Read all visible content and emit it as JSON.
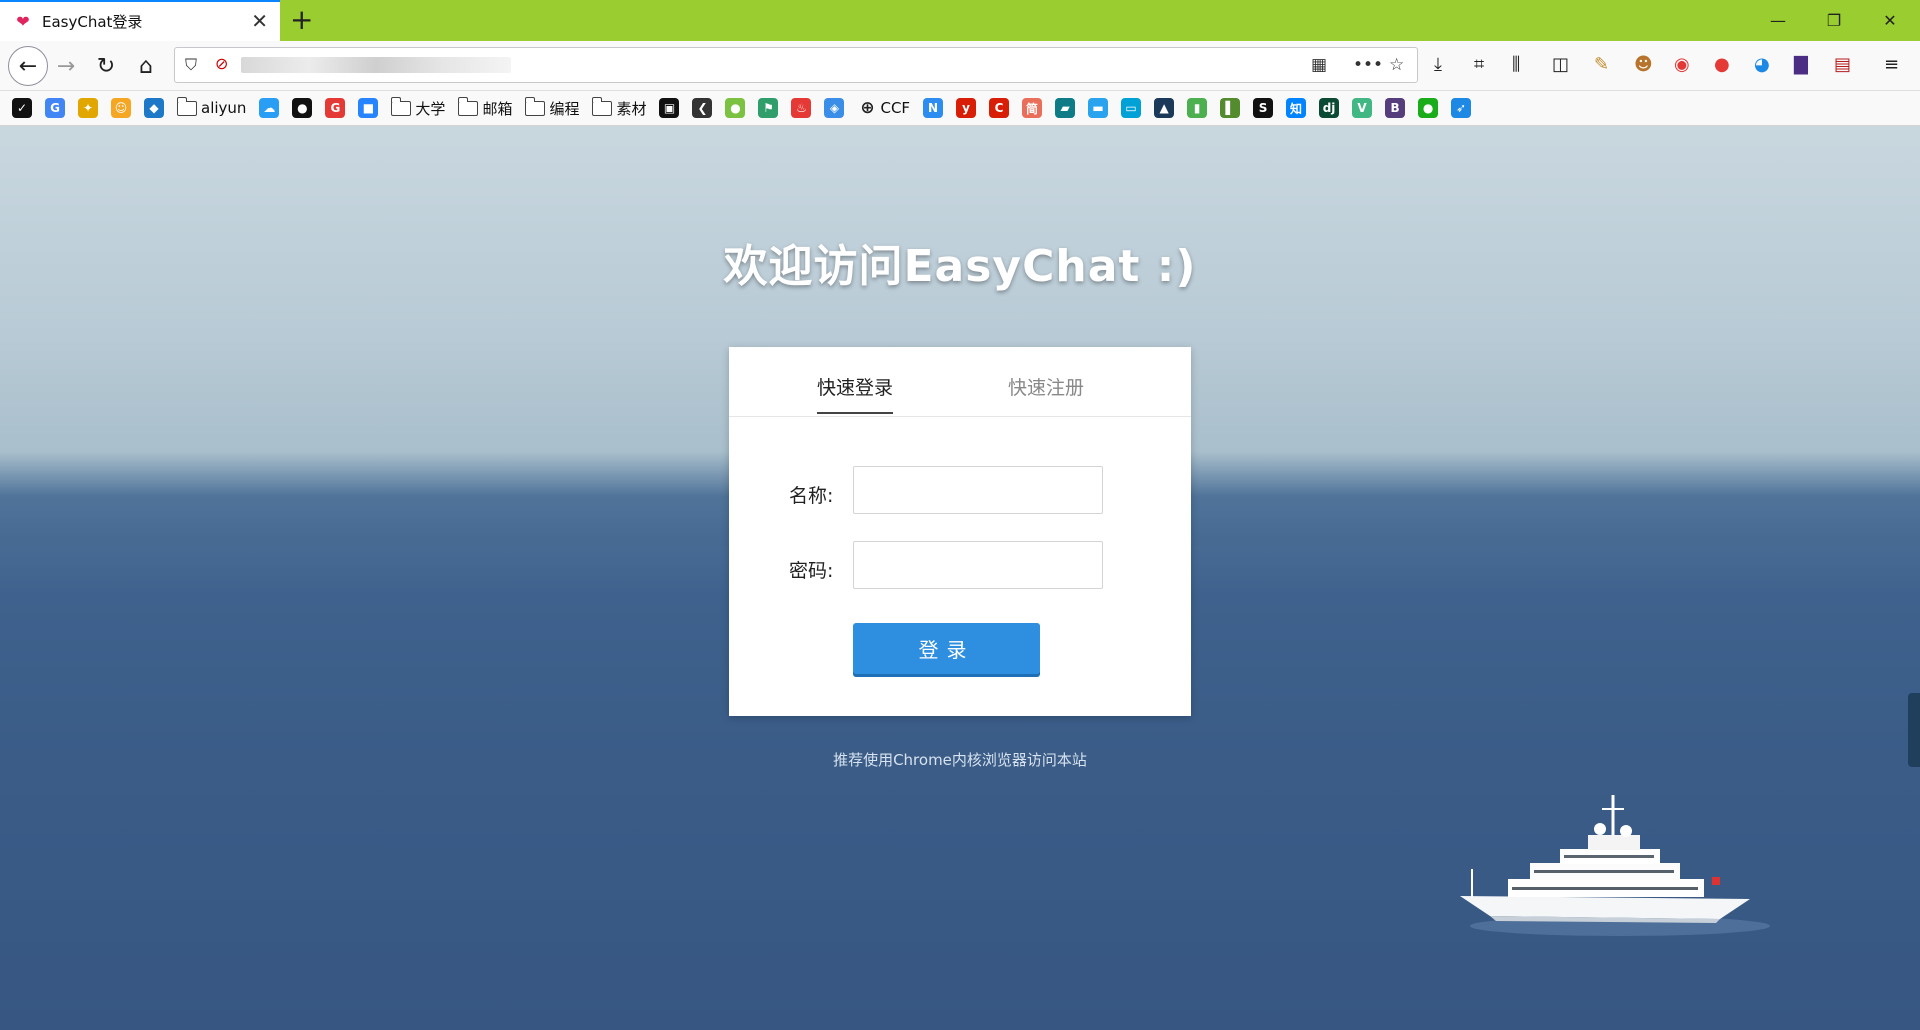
{
  "browser": {
    "tab_title": "EasyChat登录",
    "new_tab": "+",
    "window_controls": {
      "minimize": "—",
      "restore": "❐",
      "close": "✕"
    },
    "nav_icons": [
      "back-icon",
      "forward-icon",
      "reload-icon",
      "home-icon"
    ],
    "bookmarks": [
      {
        "type": "icon",
        "name": "pocket-icon",
        "glyph": "✓",
        "color": "#111111"
      },
      {
        "type": "icon",
        "name": "google-icon",
        "glyph": "G",
        "color": "#4285f4"
      },
      {
        "type": "icon",
        "name": "bird-icon",
        "glyph": "✦",
        "color": "#e2a600"
      },
      {
        "type": "icon",
        "name": "smile-icon",
        "glyph": "☺",
        "color": "#f5a623"
      },
      {
        "type": "icon",
        "name": "diamond-icon",
        "glyph": "◆",
        "color": "#1e78c8"
      },
      {
        "type": "folder",
        "label": "aliyun"
      },
      {
        "type": "icon",
        "name": "cloud-icon",
        "glyph": "☁",
        "color": "#2a9df4"
      },
      {
        "type": "icon",
        "name": "github-icon",
        "glyph": "●",
        "color": "#111111"
      },
      {
        "type": "icon",
        "name": "g-red-icon",
        "glyph": "G",
        "color": "#e53935"
      },
      {
        "type": "icon",
        "name": "bitbucket-icon",
        "glyph": "■",
        "color": "#2684ff"
      },
      {
        "type": "folder",
        "label": "大学"
      },
      {
        "type": "folder",
        "label": "邮箱"
      },
      {
        "type": "folder",
        "label": "编程"
      },
      {
        "type": "folder",
        "label": "素材"
      },
      {
        "type": "icon",
        "name": "black-box-icon",
        "glyph": "▣",
        "color": "#111111"
      },
      {
        "type": "icon",
        "name": "arrow-icon",
        "glyph": "❮",
        "color": "#333333"
      },
      {
        "type": "icon",
        "name": "green-circle-icon",
        "glyph": "●",
        "color": "#7cc242"
      },
      {
        "type": "icon",
        "name": "flag-icon",
        "glyph": "⚑",
        "color": "#2f9e6a"
      },
      {
        "type": "icon",
        "name": "fire-icon",
        "glyph": "♨",
        "color": "#e53935"
      },
      {
        "type": "icon",
        "name": "blue-gem-icon",
        "glyph": "◈",
        "color": "#3b8ee8"
      },
      {
        "type": "link",
        "name": "globe-icon",
        "glyph": "⊕",
        "label": "CCF"
      },
      {
        "type": "icon",
        "name": "n-icon",
        "glyph": "N",
        "color": "#2d8cf0"
      },
      {
        "type": "icon",
        "name": "y-icon",
        "glyph": "y",
        "color": "#d81e06"
      },
      {
        "type": "icon",
        "name": "c-icon",
        "glyph": "C",
        "color": "#d81e06"
      },
      {
        "type": "icon",
        "name": "jian-icon",
        "glyph": "简",
        "color": "#ea6f5a"
      },
      {
        "type": "icon",
        "name": "terminal-icon",
        "glyph": "▰",
        "color": "#0e7c86"
      },
      {
        "type": "icon",
        "name": "chat-box-icon",
        "glyph": "▬",
        "color": "#2aa3ef"
      },
      {
        "type": "icon",
        "name": "bilibili-icon",
        "glyph": "▭",
        "color": "#00a1d6"
      },
      {
        "type": "icon",
        "name": "grad-cap-icon",
        "glyph": "▲",
        "color": "#1b3a5a"
      },
      {
        "type": "icon",
        "name": "bars-icon",
        "glyph": "▮",
        "color": "#4caf50"
      },
      {
        "type": "icon",
        "name": "book-icon",
        "glyph": "▌",
        "color": "#558b2f"
      },
      {
        "type": "icon",
        "name": "s-icon",
        "glyph": "S",
        "color": "#111111"
      },
      {
        "type": "icon",
        "name": "zhihu-icon",
        "glyph": "知",
        "color": "#0084ff"
      },
      {
        "type": "icon",
        "name": "django-icon",
        "glyph": "dj",
        "color": "#0c4b33"
      },
      {
        "type": "icon",
        "name": "vue-icon",
        "glyph": "V",
        "color": "#41b883"
      },
      {
        "type": "icon",
        "name": "bootstrap-icon",
        "glyph": "B",
        "color": "#563d7c"
      },
      {
        "type": "icon",
        "name": "wechat-icon",
        "glyph": "●",
        "color": "#1aad19"
      },
      {
        "type": "icon",
        "name": "rocket-icon",
        "glyph": "➶",
        "color": "#1e88e5"
      }
    ]
  },
  "page": {
    "headline": "欢迎访问EasyChat :)",
    "tabs": [
      {
        "label": "快速登录",
        "active": true
      },
      {
        "label": "快速注册",
        "active": false
      }
    ],
    "name_label": "名称:",
    "password_label": "密码:",
    "name_value": "",
    "password_value": "",
    "login_button": "登录",
    "hint": "推荐使用Chrome内核浏览器访问本站"
  }
}
